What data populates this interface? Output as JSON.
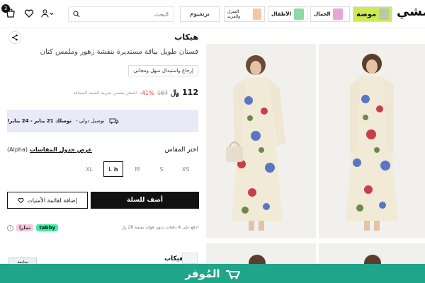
{
  "header": {
    "logo": "نمشي",
    "search_placeholder": "البحث",
    "premium_label": "بريميوم",
    "categories": [
      {
        "label": "موضة"
      },
      {
        "label": "الجمال"
      },
      {
        "label": "الأطفال"
      },
      {
        "label": "المنزل والمزيد"
      }
    ],
    "bag_count": "3"
  },
  "product": {
    "brand": "هيكاب",
    "title": "فستان طويل بياقة مستديرة بنقشة زهور وملمس كتان",
    "tag": "إرجاع واستبدال سهل ومجاني",
    "price_now": "112",
    "price_currency": "﷼",
    "price_old": "187",
    "discount": "41%-",
    "price_note": "السعر يتضمن ضريبة القيمة المضافة"
  },
  "delivery": {
    "prefix": "توصيل دولي -",
    "bold": "توصلك 21 يناير - 24 يناير!"
  },
  "size": {
    "label": "اختر المقاس",
    "chart_link": "عرض جدول المقاسات",
    "system": "(Alpha)",
    "options": [
      "XS",
      "S",
      "M",
      "L",
      "XL"
    ],
    "selected": "L"
  },
  "actions": {
    "add_to_cart": "أضف للسلة",
    "wishlist": "إضافة لقائمة الأمنيات"
  },
  "installments": {
    "text": "ادفع على 4 دفعات بدون فوائد بقيمة 28 ﷼",
    "tabby": "tabby",
    "tamara": "تمارا"
  },
  "seller": {
    "brand": "هيكاب",
    "follow": "متابعة"
  },
  "banner": {
    "text": "المُوفر"
  },
  "colors": {
    "accent_lime": "#cdea55",
    "delivery_bg": "#e9eaf8",
    "discount_red": "#e23b3b",
    "banner_green": "#1ea58a"
  }
}
